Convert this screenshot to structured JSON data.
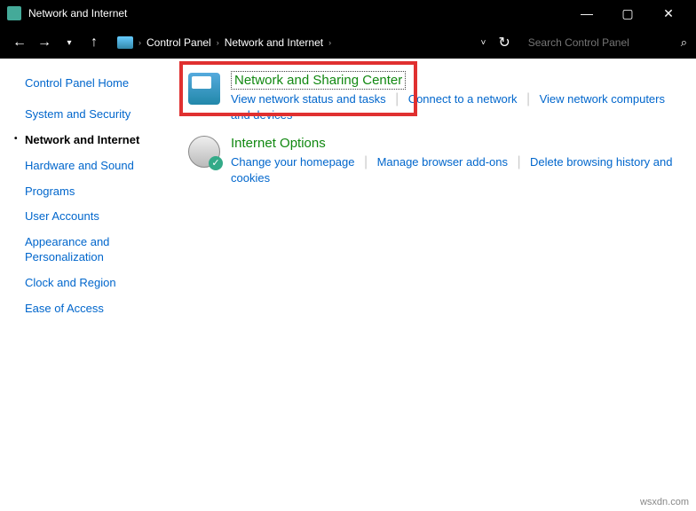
{
  "window": {
    "title": "Network and Internet"
  },
  "breadcrumb": {
    "root": "Control Panel",
    "current": "Network and Internet"
  },
  "search": {
    "placeholder": "Search Control Panel"
  },
  "sidebar": {
    "home": "Control Panel Home",
    "items": [
      "System and Security",
      "Network and Internet",
      "Hardware and Sound",
      "Programs",
      "User Accounts",
      "Appearance and Personalization",
      "Clock and Region",
      "Ease of Access"
    ],
    "activeIndex": 1
  },
  "categories": {
    "network": {
      "title": "Network and Sharing Center",
      "links": [
        "View network status and tasks",
        "Connect to a network",
        "View network computers and devices"
      ]
    },
    "internet": {
      "title": "Internet Options",
      "links": [
        "Change your homepage",
        "Manage browser add-ons",
        "Delete browsing history and cookies"
      ]
    }
  },
  "watermark": "wsxdn.com"
}
